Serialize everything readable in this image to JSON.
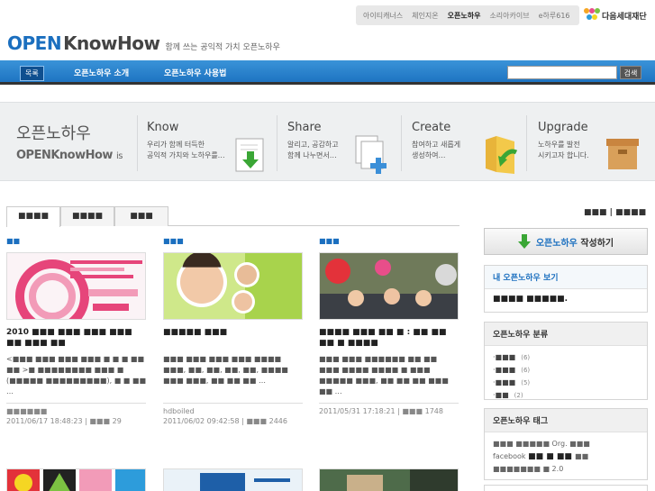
{
  "util_menu": [
    "아이티캐너스",
    "체인지온",
    "오픈노하우",
    "소리아카이브",
    "e하루616"
  ],
  "util_active_index": 2,
  "foundation": "다음세대재단",
  "logo": {
    "open": "OPEN",
    "knowhow": "KnowHow",
    "tagline": "함께 쓰는 공익적 가치 오픈노하우"
  },
  "nav": {
    "home": "목록",
    "items": [
      "오픈노하우 소개",
      "오픈노하우 사용법"
    ],
    "search_placeholder": "",
    "search_button": "검색"
  },
  "banner": {
    "intro_ko": "오픈노하우",
    "intro_en": "OPENKnowHow",
    "intro_is": "is",
    "columns": [
      {
        "head": "Know",
        "desc1": "우리가 함께 터득한",
        "desc2": "공익적 가치와 노하우를…",
        "icon": "download-doc-icon"
      },
      {
        "head": "Share",
        "desc1": "알리고, 공감하고",
        "desc2": "함께 나누면서…",
        "icon": "add-doc-icon"
      },
      {
        "head": "Create",
        "desc1": "참여하고 새롭게",
        "desc2": "생성하여…",
        "icon": "folder-arrow-icon"
      },
      {
        "head": "Upgrade",
        "desc1": "노하우를 발전",
        "desc2": "시키고자 합니다.",
        "icon": "box-icon"
      }
    ]
  },
  "tabs": [
    "■■■■",
    "■■■■",
    "■■■"
  ],
  "sort": {
    "a": "■■■",
    "sep": "|",
    "b": "■■■■"
  },
  "cards": [
    {
      "cat": "■■",
      "title": "2010 ■■■ ■■■ ■■■ ■■■ ■■ ■■■ ■■",
      "summary": "<■■■ ■■■ ■■■ ■■■ ■ ■ ■ ■■ ■■ >■ ■■■■■■■■ ■■■ ■ (■■■■■ ■■■■■■■■■), ■ ■ ■■ …",
      "author": "■■■■■■",
      "date": "2011/06/17 18:48:23",
      "views_label": "■■■",
      "views": "29"
    },
    {
      "cat": "■■■",
      "title": "■■■■■ ■■■",
      "summary": "■■■ ■■■ ■■■ ■■■ ■■■■ ■■■, ■■, ■■, ■■, ■■, ■■■■ ■■■ ■■■, ■■ ■■ ■■ …",
      "author": "hdboiled",
      "date": "2011/06/02 09:42:58",
      "views_label": "■■■",
      "views": "2446"
    },
    {
      "cat": "■■■",
      "title": "■■■■ ■■■ ■■ ■ : ■■ ■■ ■■ ■ ■■■■",
      "summary": "■■■ ■■■ ■■■■■■ ■■ ■■ ■■■ ■■■■ ■■■■ ■ ■■■ ■■■■■ ■■■, ■■ ■■ ■■ ■■■ ■■ …",
      "author": "",
      "date": "2011/05/31 17:18:21",
      "views_label": "■■■",
      "views": "1748"
    }
  ],
  "sidebar": {
    "write_brand": "오픈노하우",
    "write_label": "작성하기",
    "my_head": "내 오픈노하우 보기",
    "my_body": "■■■■ ■■■■■.",
    "cat_head": "오픈노하우 분류",
    "categories": [
      {
        "label": "■■■",
        "count": "(6)"
      },
      {
        "label": "■■■",
        "count": "(6)"
      },
      {
        "label": "■■■",
        "count": "(5)"
      },
      {
        "label": "■■",
        "count": "(2)"
      }
    ],
    "tag_head": "오픈노하우 태그",
    "tags_line1": "■■■ ■■■■■ Org. ■■■",
    "tags_line2a": "facebook ",
    "tags_line2b": "■■ ■ ■■ ",
    "tags_line2c": "■■",
    "tags_line3": "■■■■■■■ ■ 2.0"
  }
}
